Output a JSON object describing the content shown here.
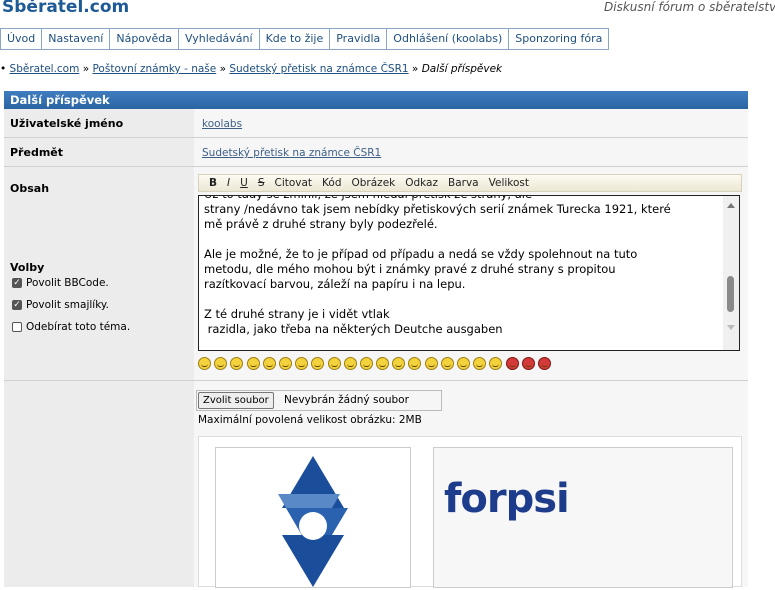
{
  "header": {
    "site_title": "Sběratel.com",
    "tagline": "Diskusní fórum o sběratelství"
  },
  "nav": {
    "items": [
      {
        "label": "Úvod"
      },
      {
        "label": "Nastavení"
      },
      {
        "label": "Nápověda"
      },
      {
        "label": "Vyhledávání"
      },
      {
        "label": "Kde to žije"
      },
      {
        "label": "Pravidla"
      },
      {
        "label": "Odhlášení (koolabs)"
      },
      {
        "label": "Sponzoring fóra"
      }
    ]
  },
  "breadcrumb": {
    "items": [
      "Sběratel.com",
      "Poštovní známky - naše",
      "Sudetský přetisk na známce ČSR1"
    ],
    "separator": "»",
    "current": "Další příspěvek"
  },
  "form": {
    "title": "Další příspěvek",
    "username_label": "Uživatelské jméno",
    "username_value": "koolabs",
    "subject_label": "Předmět",
    "subject_value": "Sudetský přetisk na známce ČSR1",
    "content_label": "Obsah",
    "toolbar": [
      "B",
      "I",
      "U",
      "S",
      "Citovat",
      "Kód",
      "Obrázek",
      "Odkaz",
      "Barva",
      "Velikost"
    ],
    "editor_text": "Už to tady se zmínil, že jsem hledal přetisk ze strany, ale\nstrany /nedávno tak jsem nebídky přetiskových serií známek Turecka 1921, které\nmě právě z druhé strany byly podezřelé.\n\nAle je možné, že to je případ od případu a nedá se vždy spolehnout na tuto\nmetodu, dle mého mohou být i známky pravé z druhé strany s propitou\nrazítkovací barvou, záleží na papíru i na lepu.\n\nZ té druhé strany je i vidět vtlak\n razidla, jako třeba na některých Deutche ausgaben",
    "options_label": "Volby",
    "options": [
      {
        "label": "Povolit BBCode.",
        "checked": true
      },
      {
        "label": "Povolit smajlíky.",
        "checked": true
      },
      {
        "label": "Odebírat toto téma.",
        "checked": false
      }
    ],
    "file_button": "Zvolit soubor",
    "file_none": "Nevybrán žádný soubor",
    "max_size": "Maximální povolená velikost obrázku: 2MB",
    "ad_text": "forpsi"
  },
  "colors": {
    "accent": "#2b64a3",
    "link": "#1e4f80",
    "title": "#1e5a96"
  }
}
